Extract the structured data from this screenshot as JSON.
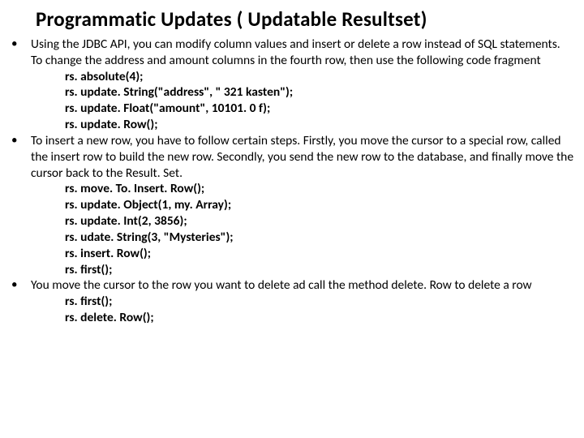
{
  "title": "Programmatic Updates  ( Updatable Resultset)",
  "bullets": [
    {
      "text": "Using the JDBC API, you can modify column values and insert or delete a row instead of SQL statements. To change the address and amount columns in the fourth row, then use the following code fragment",
      "code": [
        "rs. absolute(4);",
        "rs. update. String(\"address\", \" 321 kasten\");",
        "rs. update. Float(\"amount\", 10101. 0 f);",
        "rs. update. Row();"
      ]
    },
    {
      "text": "To insert a new row, you have to follow certain steps. Firstly, you move the cursor to a special row, called the insert row to build the new row. Secondly, you send the new row to the database, and finally move the cursor back to the Result. Set.",
      "code": [
        "rs. move. To. Insert. Row();",
        "rs. update. Object(1, my. Array);",
        "rs. update. Int(2, 3856);",
        "rs. udate. String(3, \"Mysteries\");",
        "rs. insert. Row();",
        "rs. first();"
      ]
    },
    {
      "text": "You move the cursor to the row you want to delete ad call the method delete. Row to delete a row",
      "code": [
        "rs. first();",
        "rs. delete. Row();"
      ]
    }
  ]
}
